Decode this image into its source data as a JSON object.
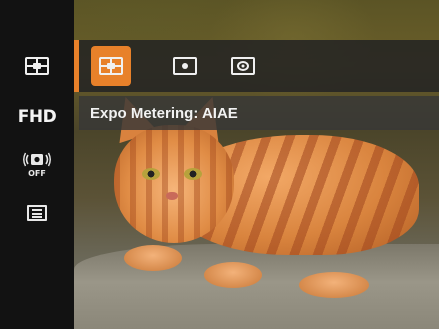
{
  "sidebar": {
    "items": [
      {
        "name": "metering",
        "icon": "ai-metering-icon"
      },
      {
        "name": "video-quality",
        "label": "FHD"
      },
      {
        "name": "stabilization",
        "icon": "image-stabilization-off-icon",
        "value": "OFF"
      },
      {
        "name": "menu",
        "icon": "menu-list-icon"
      }
    ]
  },
  "options": {
    "items": [
      {
        "name": "AiAE",
        "icon": "ai-metering-icon",
        "selected": true
      },
      {
        "name": "Spot",
        "icon": "spot-metering-icon",
        "selected": false
      },
      {
        "name": "Center-weighted",
        "icon": "center-weighted-metering-icon",
        "selected": false
      }
    ]
  },
  "caption": {
    "text": "Expo Metering: AIAE"
  },
  "colors": {
    "accent": "#e8812a",
    "panel": "#121212",
    "option_bar": "#232323",
    "caption_bar": "#373737",
    "text": "#f2f2f2"
  }
}
